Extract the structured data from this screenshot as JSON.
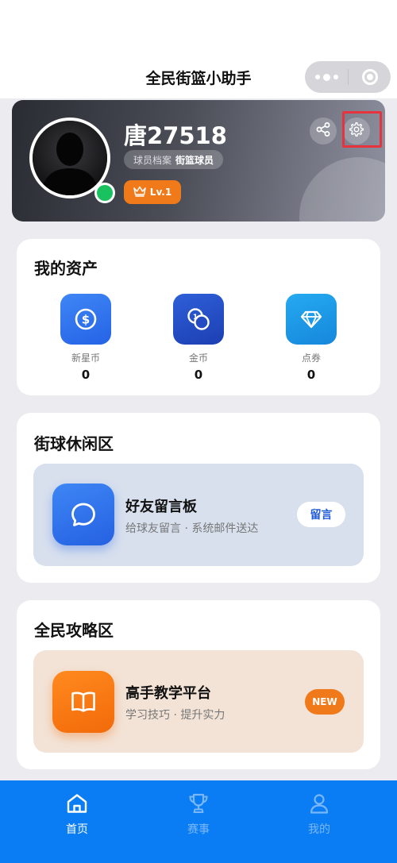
{
  "app": {
    "title": "全民街篮小助手"
  },
  "profile": {
    "username": "唐27518",
    "archive_label": "球员档案",
    "archive_value": "街篮球员",
    "level": "Lv.1"
  },
  "assets": {
    "title": "我的资产",
    "items": [
      {
        "name": "新星币",
        "value": "0",
        "icon": "dollar-coin-icon",
        "color": "#2f74f0"
      },
      {
        "name": "金币",
        "value": "0",
        "icon": "coins-icon",
        "color": "#1f4fc9"
      },
      {
        "name": "点券",
        "value": "0",
        "icon": "diamond-icon",
        "color": "#1a96e6"
      }
    ]
  },
  "leisure": {
    "title": "街球休闲区",
    "feature_title": "好友留言板",
    "feature_subtitle": "给球友留言 · 系统邮件送达",
    "action_label": "留言"
  },
  "strategy": {
    "title": "全民攻略区",
    "feature_title": "高手教学平台",
    "feature_subtitle": "学习技巧 · 提升实力",
    "badge": "NEW"
  },
  "tabs": [
    {
      "label": "首页",
      "icon": "home-icon",
      "active": true
    },
    {
      "label": "赛事",
      "icon": "trophy-icon",
      "active": false
    },
    {
      "label": "我的",
      "icon": "user-icon",
      "active": false
    }
  ],
  "colors": {
    "accent": "#0a7df5",
    "orange": "#f07a1a",
    "online": "#19c15f",
    "highlight": "#e8333e"
  }
}
